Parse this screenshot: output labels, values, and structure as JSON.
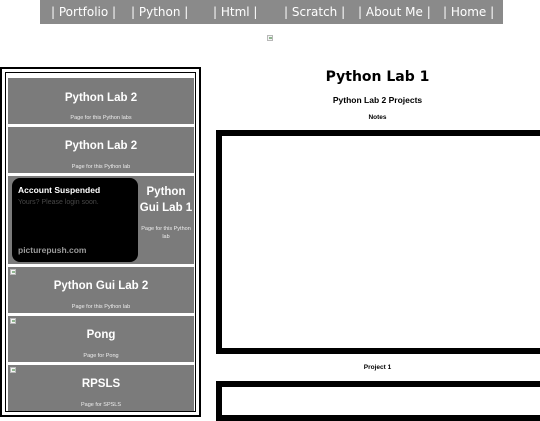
{
  "nav": {
    "items": [
      "| Portfolio |",
      "| Python |",
      "| Html |",
      "| Scratch |",
      "| About Me |",
      "| Home |"
    ]
  },
  "sidebar": {
    "cards": [
      {
        "title": "Python Lab 2",
        "desc": "Page for this Python labs"
      },
      {
        "title": "Python Lab 2",
        "desc": "Page for this Python lab"
      },
      {
        "title": "Python Gui Lab 1",
        "desc": "Page for this Python lab",
        "title_lines": [
          "Python",
          "Gui Lab 1"
        ],
        "desc_lines": [
          "Page for this Python",
          "lab"
        ]
      },
      {
        "title": "Python Gui Lab 2",
        "desc": "Page for this Python lab"
      },
      {
        "title": "Pong",
        "desc": "Page for Pong"
      },
      {
        "title": "RPSLS",
        "desc": "Page for SPSLS"
      }
    ],
    "thumbnail": {
      "heading": "Account Suspended",
      "message": "Yours? Please login soon.",
      "brand": "picturepush.com"
    }
  },
  "main": {
    "title": "Python Lab 1",
    "subtitle": "Python Lab 2 Projects",
    "notes_label": "Notes",
    "project_caption": "Project 1"
  },
  "colors": {
    "nav_bg": "#8a8a8a",
    "card_bg": "#7b7b7b",
    "frame_border": "#000000"
  }
}
